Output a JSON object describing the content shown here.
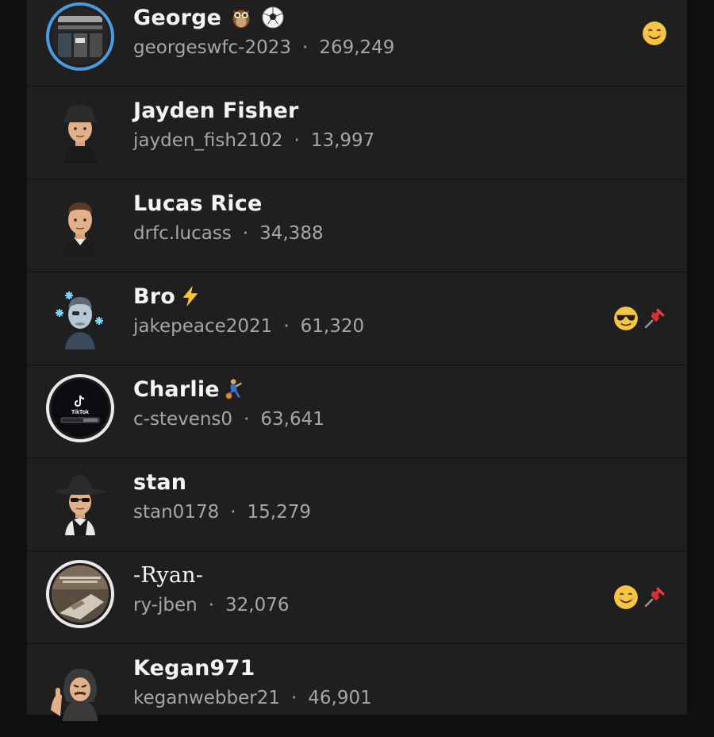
{
  "friends": [
    {
      "name": "George",
      "username": "georgeswfc-2023",
      "score": "269,249",
      "name_icons": [
        "owl-emoji",
        "soccer-ball-emoji"
      ],
      "right_icons": [
        "smiling-face-emoji"
      ],
      "avatar": "story-ring-blue"
    },
    {
      "name": "Jayden Fisher",
      "username": "jayden_fish2102",
      "score": "13,997",
      "name_icons": [],
      "right_icons": [],
      "avatar": "bitmoji-bucket-hat"
    },
    {
      "name": "Lucas Rice",
      "username": "drfc.lucass",
      "score": "34,388",
      "name_icons": [],
      "right_icons": [],
      "avatar": "bitmoji-short-hair"
    },
    {
      "name": "Bro",
      "username": "jakepeace2021",
      "score": "61,320",
      "name_icons": [
        "lightning-emoji"
      ],
      "right_icons": [
        "sunglasses-face-emoji",
        "pushpin-emoji"
      ],
      "avatar": "bitmoji-frozen"
    },
    {
      "name": "Charlie",
      "username": "c-stevens0",
      "score": "63,641",
      "name_icons": [
        "basketball-player-emoji"
      ],
      "right_icons": [],
      "avatar": "story-ring-white-tiktok",
      "avatar_text": "TikTok"
    },
    {
      "name": "stan",
      "username": "stan0178",
      "score": "15,279",
      "name_icons": [],
      "right_icons": [],
      "avatar": "bitmoji-fedora-sunglasses"
    },
    {
      "name": "-Ryan-",
      "username": "ry-jben",
      "score": "32,076",
      "name_icons": [],
      "right_icons": [
        "smiling-face-emoji",
        "pushpin-emoji"
      ],
      "avatar": "story-ring-white"
    },
    {
      "name": "Kegan971",
      "username": "keganwebber21",
      "score": "46,901",
      "name_icons": [],
      "right_icons": [],
      "avatar": "bitmoji-hood-gesture"
    }
  ],
  "separator": "·",
  "colors": {
    "background": "#0f0f0f",
    "panel": "#1f1f20",
    "name_text": "#f4f4f4",
    "sub_text": "#a6a6a6",
    "story_ring_blue": "#4a9bde",
    "story_ring_white": "#e9e9e9"
  }
}
